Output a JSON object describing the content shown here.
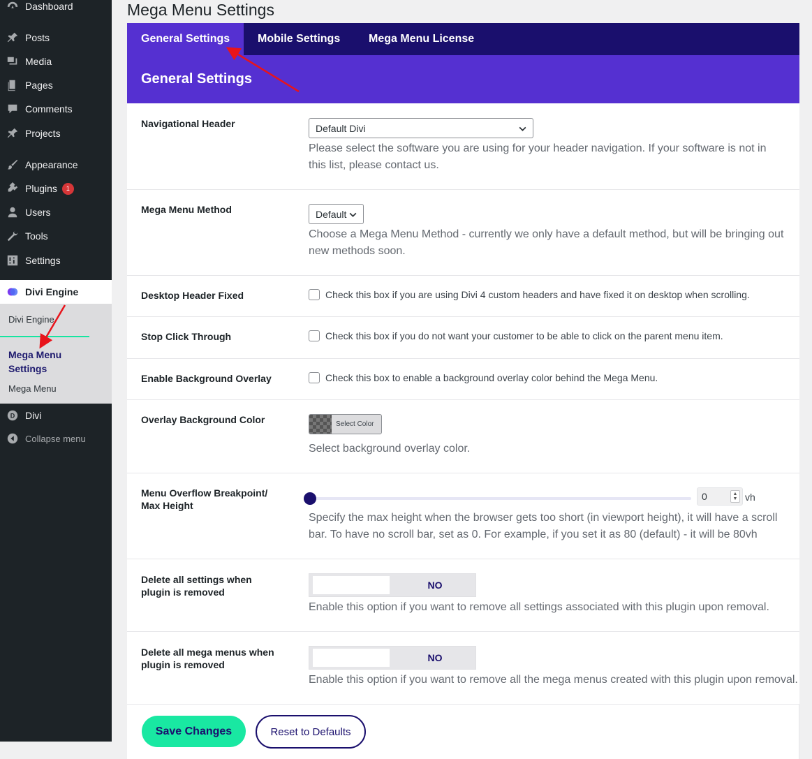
{
  "sidebar": {
    "items": [
      {
        "label": "Dashboard",
        "icon": "dashboard-icon"
      },
      {
        "label": "Posts",
        "icon": "pin-icon"
      },
      {
        "label": "Media",
        "icon": "media-icon"
      },
      {
        "label": "Pages",
        "icon": "pages-icon"
      },
      {
        "label": "Comments",
        "icon": "comment-icon"
      },
      {
        "label": "Projects",
        "icon": "pin-icon"
      },
      {
        "label": "Appearance",
        "icon": "brush-icon"
      },
      {
        "label": "Plugins",
        "icon": "plug-icon",
        "badge": "1"
      },
      {
        "label": "Users",
        "icon": "user-icon"
      },
      {
        "label": "Tools",
        "icon": "wrench-icon"
      },
      {
        "label": "Settings",
        "icon": "sliders-icon"
      }
    ],
    "divi_engine": {
      "label": "Divi Engine",
      "icon": "divi-engine-logo-icon"
    },
    "submenu": {
      "item1": "Divi Engine",
      "current": "Mega Menu Settings",
      "item3": "Mega Menu"
    },
    "divi": {
      "label": "Divi",
      "icon": "divi-icon"
    },
    "collapse": {
      "label": "Collapse menu",
      "icon": "collapse-icon"
    }
  },
  "page": {
    "title": "Mega Menu Settings",
    "tabs": [
      "General Settings",
      "Mobile Settings",
      "Mega Menu License"
    ],
    "active_tab": "General Settings",
    "section_title": "General Settings"
  },
  "settings": {
    "nav_header": {
      "label": "Navigational Header",
      "value": "Default Divi",
      "desc": "Please select the software you are using for your header navigation. If your software is not in this list, please contact us."
    },
    "method": {
      "label": "Mega Menu Method",
      "value": "Default",
      "desc": "Choose a Mega Menu Method - currently we only have a default method, but will be bringing out new methods soon."
    },
    "desktop_fixed": {
      "label": "Desktop Header Fixed",
      "text": "Check this box if you are using Divi 4 custom headers and have fixed it on desktop when scrolling.",
      "checked": false
    },
    "stop_click": {
      "label": "Stop Click Through",
      "text": "Check this box if you do not want your customer to be able to click on the parent menu item.",
      "checked": false
    },
    "bg_overlay": {
      "label": "Enable Background Overlay",
      "text": "Check this box to enable a background overlay color behind the Mega Menu.",
      "checked": false
    },
    "overlay_color": {
      "label": "Overlay Background Color",
      "button": "Select Color",
      "desc": "Select background overlay color."
    },
    "overflow": {
      "label": "Menu Overflow Breakpoint/ Max Height",
      "value": "0",
      "unit": "vh",
      "slider_fraction": 0,
      "desc": "Specify the max height when the browser gets too short (in viewport height), it will have a scroll bar. To have no scroll bar, set as 0. For example, if you set it as 80 (default) - it will be 80vh"
    },
    "delete_settings": {
      "label": "Delete all settings when plugin is removed",
      "toggle": "NO",
      "desc": "Enable this option if you want to remove all settings associated with this plugin upon removal."
    },
    "delete_menus": {
      "label": "Delete all mega menus when plugin is removed",
      "toggle": "NO",
      "desc": "Enable this option if you want to remove all the mega menus created with this plugin upon removal."
    }
  },
  "footer": {
    "save": "Save Changes",
    "reset": "Reset to Defaults"
  },
  "colors": {
    "sidebar_bg": "#1d2327",
    "tab_bar": "#1a0f6d",
    "accent_purple": "#5530d1",
    "save_green": "#19e8a2",
    "badge_red": "#d63638",
    "annotation_red": "#e8141b"
  }
}
